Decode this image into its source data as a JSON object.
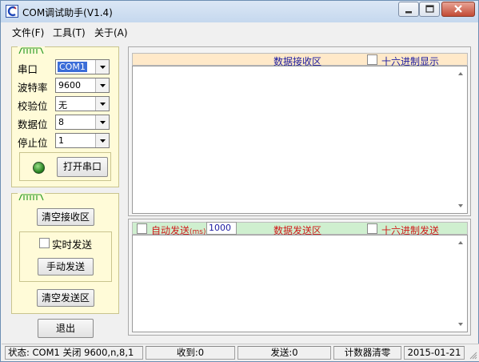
{
  "window": {
    "title": "COM调试助手(V1.4)",
    "minimize_icon": "minimize-icon",
    "maximize_icon": "maximize-icon",
    "close_icon": "close-icon"
  },
  "menubar": {
    "items": [
      {
        "label": "文件(F)"
      },
      {
        "label": "工具(T)"
      },
      {
        "label": "关于(A)"
      }
    ]
  },
  "serial_settings": {
    "group_tag": "/iiiii\\",
    "port": {
      "label": "串口",
      "value": "COM1"
    },
    "baud": {
      "label": "波特率",
      "value": "9600"
    },
    "parity": {
      "label": "校验位",
      "value": "无"
    },
    "databits": {
      "label": "数据位",
      "value": "8"
    },
    "stopbits": {
      "label": "停止位",
      "value": "1"
    },
    "status_led_color": "#2f9e2a",
    "open_port_button": "打开串口"
  },
  "send_controls": {
    "group_tag": "/iiiii\\",
    "clear_receive_button": "清空接收区",
    "realtime_send_label": "实时发送",
    "realtime_send_checked": false,
    "manual_send_button": "手动发送",
    "clear_send_button": "清空发送区",
    "exit_button": "退出"
  },
  "receive_area": {
    "title": "数据接收区",
    "hex_display_label": "十六进制显示",
    "hex_display_checked": false,
    "header_bg": "#ffe9c9",
    "title_color": "#1a1aa0",
    "content": ""
  },
  "send_area": {
    "auto_send_label": "自动发送",
    "auto_send_unit": "(ms)",
    "auto_send_checked": false,
    "interval_value": "1000",
    "title": "数据发送区",
    "hex_send_label": "十六进制发送",
    "hex_send_checked": false,
    "header_bg": "#cfefcf",
    "title_color": "#d01b1b",
    "content": ""
  },
  "statusbar": {
    "state": "状态: COM1 关闭 9600,n,8,1",
    "received": "收到:0",
    "sent": "发送:0",
    "reset_counter": "计数器清零",
    "date": "2015-01-21"
  },
  "colors": {
    "accent_blue": "#1a1aa0",
    "accent_red": "#d01b1b",
    "panel_yellow": "#fffbd8"
  }
}
